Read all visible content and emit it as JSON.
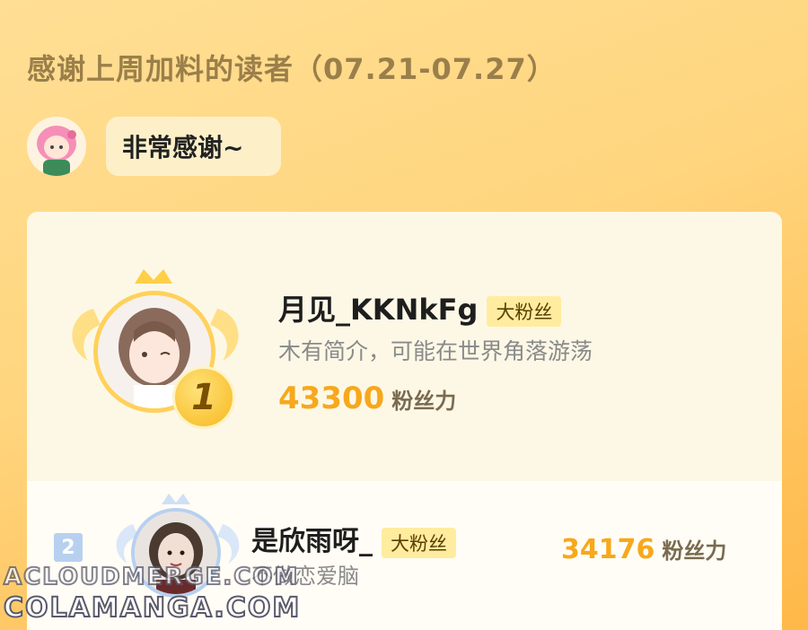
{
  "header": {
    "title": "感谢上周加料的读者（07.21-07.27）"
  },
  "mascot": {
    "bubble_text": "非常感谢~"
  },
  "leaderboard": [
    {
      "rank": "1",
      "name": "月见_KKNkFg",
      "badge": "大粉丝",
      "bio": "木有简介，可能在世界角落游荡",
      "score": "43300",
      "score_unit": "粉丝力"
    },
    {
      "rank": "2",
      "name": "是欣雨呀_",
      "badge": "大粉丝",
      "bio": "不做恋爱脑",
      "score": "34176",
      "score_unit": "粉丝力"
    }
  ],
  "watermarks": [
    "ACLOUDMERGE.COM",
    "COLAMANGA.COM"
  ],
  "colors": {
    "accent_score": "#f7a81b",
    "gold": "#ffd15b",
    "silver_blue": "#b8d0f0",
    "badge_bg": "#ffec9f"
  }
}
